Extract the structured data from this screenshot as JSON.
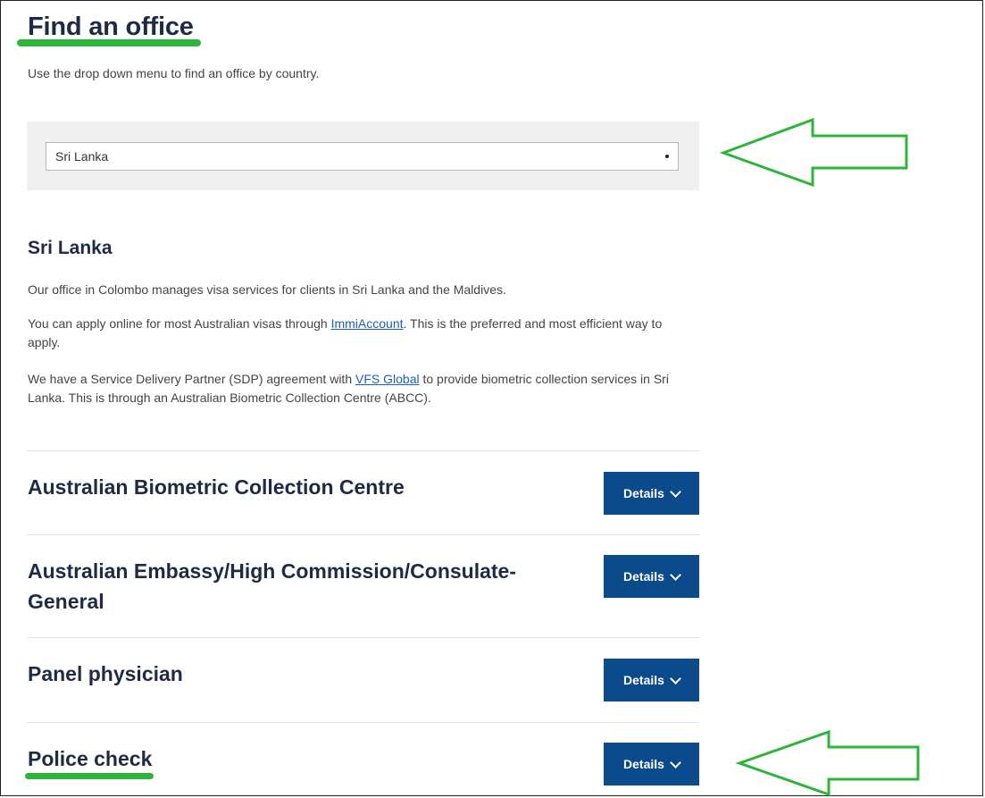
{
  "header": {
    "title": "Find an office",
    "intro": "Use the drop down menu to find an office by country."
  },
  "country_select": {
    "selected": "Sri Lanka"
  },
  "country": {
    "heading": "Sri Lanka",
    "p1": "Our office in Colombo manages visa services for clients in Sri Lanka and the Maldives.",
    "p2_before": "You can apply online for most Australian visas through ",
    "p2_link": "ImmiAccount",
    "p2_after": ". This is the preferred and most efficient way to apply.",
    "p3_before": "We have a Service Delivery Partner (SDP) agreement with ",
    "p3_link": "VFS Global",
    "p3_after": " to provide biometric collection services in Sri Lanka. This is through an Australian Biometric Collection Centre (ABCC)."
  },
  "sections": [
    {
      "title": "Australian Biometric Collection Centre",
      "button": "Details"
    },
    {
      "title": "Australian Embassy/High Commission/Consulate-General",
      "button": "Details"
    },
    {
      "title": "Panel physician",
      "button": "Details"
    },
    {
      "title": "Police check",
      "button": "Details"
    }
  ],
  "colors": {
    "annotation_green": "#2db43a",
    "button_blue": "#0b4a8b",
    "link_blue": "#1a5fb4",
    "heading_navy": "#1f2a44"
  }
}
